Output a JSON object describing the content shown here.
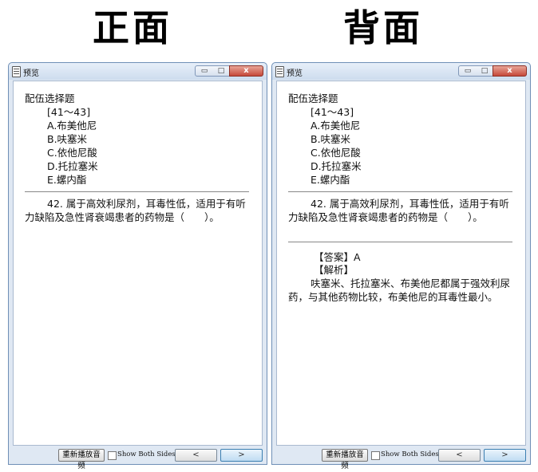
{
  "headings": {
    "front": "正面",
    "back": "背面"
  },
  "window_title": "预览",
  "controls": {
    "minimize": "▭",
    "maximize": "□",
    "close": "x"
  },
  "question": {
    "type": "配伍选择题",
    "range": "[41～43]",
    "options": [
      "A.布美他尼",
      "B.呋塞米",
      "C.依他尼酸",
      "D.托拉塞米",
      "E.螺内酯"
    ],
    "stem": "42. 属于高效利尿剂，耳毒性低，适用于有听力缺陷及急性肾衰竭患者的药物是（　　）。"
  },
  "answer": {
    "label": "【答案】A",
    "explanation_label": "【解析】",
    "explanation": "呋塞米、托拉塞米、布美他尼都属于强效利尿药，与其他药物比较，布美他尼的耳毒性最小。"
  },
  "bottom": {
    "replay": "重新播放音频",
    "show_both": "Show Both Sides",
    "prev": "<",
    "next": ">"
  }
}
